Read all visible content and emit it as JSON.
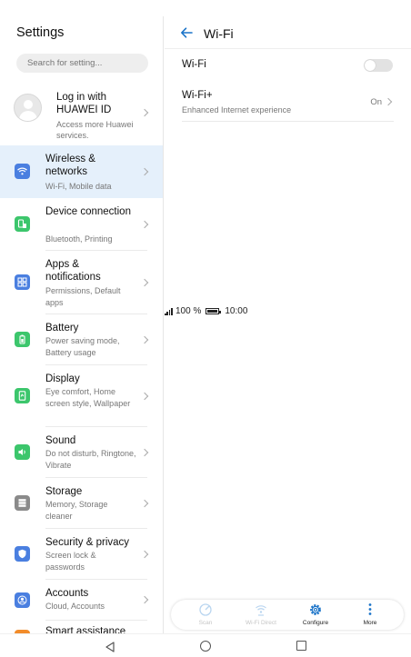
{
  "status_bar": {
    "battery": "100 %",
    "time": "10:00",
    "icons": [
      "signal-icon",
      "battery-icon"
    ]
  },
  "left_panel": {
    "title": "Settings",
    "search_placeholder": "Search for setting...",
    "account": {
      "title": "Log in with HUAWEI ID",
      "subtitle": "Access more Huawei services."
    },
    "items": [
      {
        "title": "Wireless & networks",
        "subtitle": "Wi-Fi, Mobile data",
        "icon": "wifi-icon",
        "color": "#4a7fe0",
        "active": true
      },
      {
        "title": "Device connection",
        "subtitle": "Bluetooth, Printing",
        "icon": "device-connection-icon",
        "color": "#3cc66c"
      },
      {
        "title": "Apps & notifications",
        "subtitle": "Permissions, Default apps",
        "icon": "apps-icon",
        "color": "#4a7fe0"
      },
      {
        "title": "Battery",
        "subtitle": "Power saving mode, Battery usage",
        "icon": "battery-icon",
        "color": "#3cc66c"
      },
      {
        "title": "Display",
        "subtitle": "Eye comfort, Home screen style, Wallpaper",
        "icon": "display-icon",
        "color": "#3cc66c"
      },
      {
        "title": "Sound",
        "subtitle": "Do not disturb, Ringtone, Vibrate",
        "icon": "sound-icon",
        "color": "#3cc66c"
      },
      {
        "title": "Storage",
        "subtitle": "Memory, Storage cleaner",
        "icon": "storage-icon",
        "color": "#8a8a8a"
      },
      {
        "title": "Security & privacy",
        "subtitle": "Screen lock & passwords",
        "icon": "shield-icon",
        "color": "#4a7fe0"
      },
      {
        "title": "Accounts",
        "subtitle": "Cloud, Accounts",
        "icon": "account-icon",
        "color": "#4a7fe0"
      },
      {
        "title": "Smart assistance",
        "subtitle": "",
        "icon": "smart-assistance-icon",
        "color": "#f28c2a"
      }
    ]
  },
  "right_panel": {
    "title": "Wi-Fi",
    "wifi_row": {
      "label": "Wi-Fi",
      "enabled": false
    },
    "wifiplus_row": {
      "label": "Wi-Fi+",
      "subtitle": "Enhanced Internet experience",
      "value": "On"
    },
    "bottom_actions": [
      {
        "label": "Scan",
        "icon": "scan-icon",
        "enabled": false
      },
      {
        "label": "Wi-Fi Direct",
        "icon": "wifi-direct-icon",
        "enabled": false
      },
      {
        "label": "Configure",
        "icon": "gear-icon",
        "enabled": true
      },
      {
        "label": "More",
        "icon": "more-icon",
        "enabled": true
      }
    ]
  },
  "colors": {
    "accent": "#1a73c8",
    "active_bg": "#e5f0fb"
  }
}
